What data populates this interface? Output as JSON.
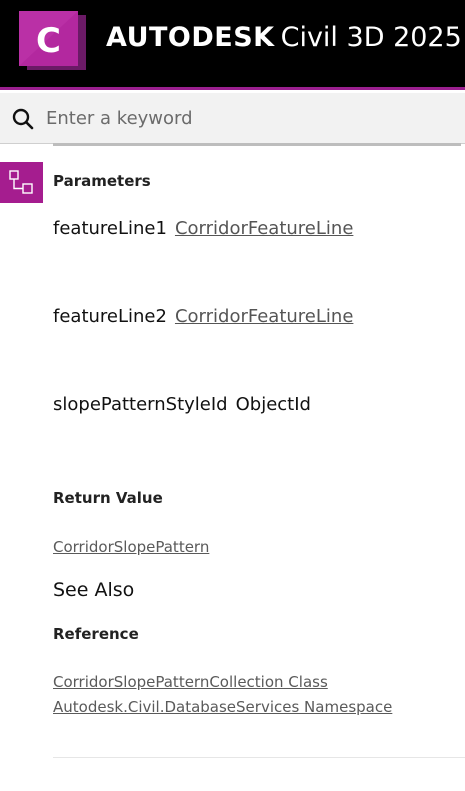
{
  "header": {
    "logo_letter": "C",
    "brand_company": "AUTODESK",
    "brand_product": "Civil 3D 2025"
  },
  "search": {
    "placeholder": "Enter a keyword",
    "value": ""
  },
  "colors": {
    "brand_purple": "#a51d8f",
    "header_bg": "#000000"
  },
  "parameters": {
    "heading": "Parameters",
    "items": [
      {
        "name": "featureLine1",
        "type": "CorridorFeatureLine",
        "type_is_link": true
      },
      {
        "name": "featureLine2",
        "type": "CorridorFeatureLine",
        "type_is_link": true
      },
      {
        "name": "slopePatternStyleId",
        "type": "ObjectId",
        "type_is_link": false
      }
    ]
  },
  "return_value": {
    "heading": "Return Value",
    "type": "CorridorSlopePattern"
  },
  "see_also": {
    "heading": "See Also",
    "reference_heading": "Reference",
    "links": [
      "CorridorSlopePatternCollection Class",
      "Autodesk.Civil.DatabaseServices Namespace"
    ]
  }
}
